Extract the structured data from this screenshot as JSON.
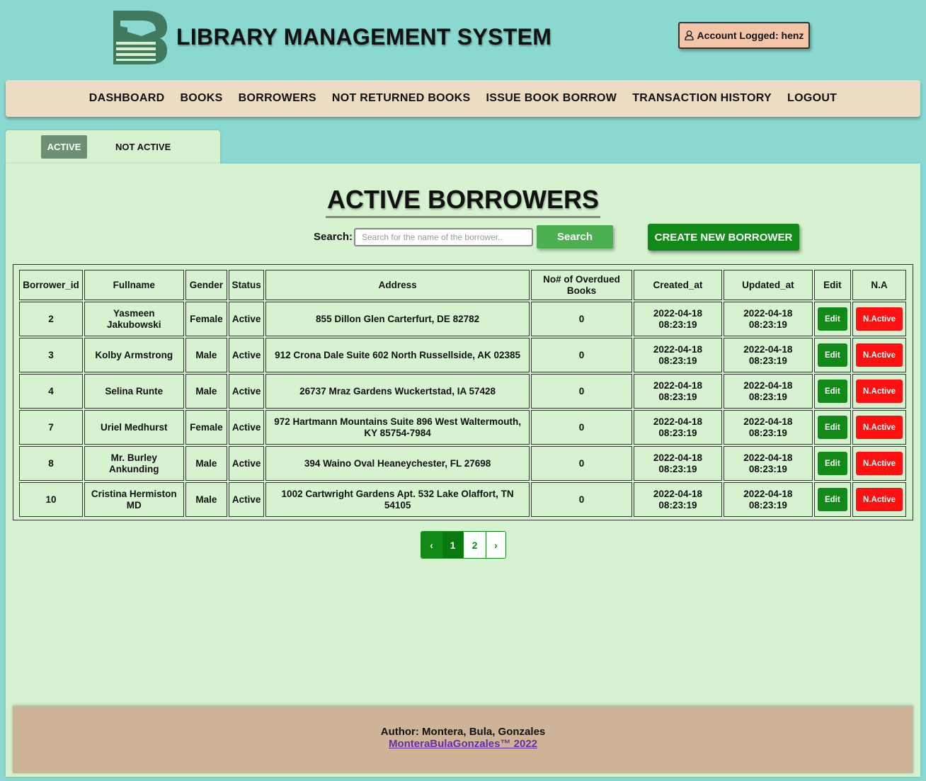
{
  "header": {
    "title": "LIBRARY MANAGEMENT SYSTEM",
    "account": "Account Logged: henz"
  },
  "nav": {
    "items": [
      {
        "label": "DASHBOARD"
      },
      {
        "label": "BOOKS"
      },
      {
        "label": "BORROWERS"
      },
      {
        "label": "NOT RETURNED BOOKS"
      },
      {
        "label": "ISSUE BOOK BORROW"
      },
      {
        "label": "TRANSACTION HISTORY"
      },
      {
        "label": "LOGOUT"
      }
    ]
  },
  "tabs": {
    "active": "ACTIVE",
    "inactive": "NOT ACTIVE"
  },
  "main": {
    "title": "ACTIVE BORROWERS",
    "search_label": "Search:",
    "search_placeholder": "Search for the name of the borrower..",
    "search_button": "Search",
    "create_button": "CREATE NEW BORROWER"
  },
  "table": {
    "headers": [
      "Borrower_id",
      "Fullname",
      "Gender",
      "Status",
      "Address",
      "No# of Overdued Books",
      "Created_at",
      "Updated_at",
      "Edit",
      "N.A"
    ],
    "edit_label": "Edit",
    "na_label": "N.Active",
    "rows": [
      {
        "id": "2",
        "fullname": "Yasmeen Jakubowski",
        "gender": "Female",
        "status": "Active",
        "address": "855 Dillon Glen Carterfurt, DE 82782",
        "overdue": "0",
        "created": "2022-04-18 08:23:19",
        "updated": "2022-04-18 08:23:19"
      },
      {
        "id": "3",
        "fullname": "Kolby Armstrong",
        "gender": "Male",
        "status": "Active",
        "address": "912 Crona Dale Suite 602 North Russellside, AK 02385",
        "overdue": "0",
        "created": "2022-04-18 08:23:19",
        "updated": "2022-04-18 08:23:19"
      },
      {
        "id": "4",
        "fullname": "Selina Runte",
        "gender": "Male",
        "status": "Active",
        "address": "26737 Mraz Gardens Wuckertstad, IA 57428",
        "overdue": "0",
        "created": "2022-04-18 08:23:19",
        "updated": "2022-04-18 08:23:19"
      },
      {
        "id": "7",
        "fullname": "Uriel Medhurst",
        "gender": "Female",
        "status": "Active",
        "address": "972 Hartmann Mountains Suite 896 West Waltermouth, KY 85754-7984",
        "overdue": "0",
        "created": "2022-04-18 08:23:19",
        "updated": "2022-04-18 08:23:19"
      },
      {
        "id": "8",
        "fullname": "Mr. Burley Ankunding",
        "gender": "Male",
        "status": "Active",
        "address": "394 Waino Oval Heaneychester, FL 27698",
        "overdue": "0",
        "created": "2022-04-18 08:23:19",
        "updated": "2022-04-18 08:23:19"
      },
      {
        "id": "10",
        "fullname": "Cristina Hermiston MD",
        "gender": "Male",
        "status": "Active",
        "address": "1002 Cartwright Gardens Apt. 532 Lake Olaffort, TN 54105",
        "overdue": "0",
        "created": "2022-04-18 08:23:19",
        "updated": "2022-04-18 08:23:19"
      }
    ]
  },
  "pagination": {
    "prev": "‹",
    "current": "1",
    "page2": "2",
    "next": "›"
  },
  "footer": {
    "author": "Author: Montera, Bula, Gonzales",
    "link": "MonteraBulaGonzales™ 2022"
  },
  "colors": {
    "background": "#8ad9d0",
    "panel": "#d6f2d1",
    "primary_green": "#118a17",
    "danger_red": "#ff1010"
  }
}
